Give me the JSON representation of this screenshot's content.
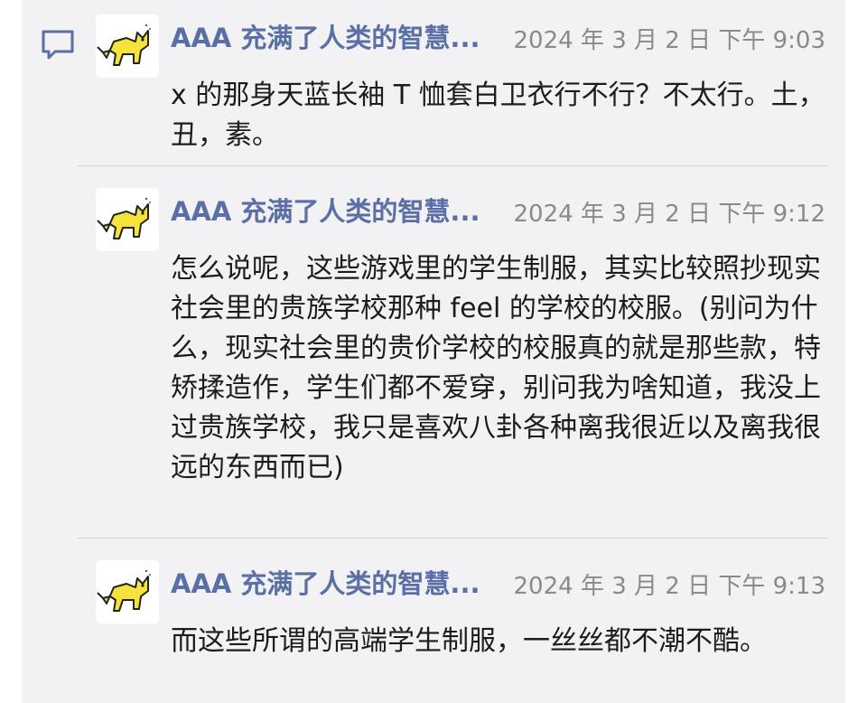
{
  "comments": [
    {
      "author": "AAA 充满了人类的智慧...",
      "time": "2024 年 3 月 2 日 下午 9:03",
      "text": "x 的那身天蓝长袖 T 恤套白卫衣行不行？不太行。土，丑，素。"
    },
    {
      "author": "AAA 充满了人类的智慧...",
      "time": "2024 年 3 月 2 日 下午 9:12",
      "text": "怎么说呢，这些游戏里的学生制服，其实比较照抄现实社会里的贵族学校那种 feel 的学校的校服。(别问为什么，现实社会里的贵价学校的校服真的就是那些款，特矫揉造作，学生们都不爱穿，别问我为啥知道，我没上过贵族学校，我只是喜欢八卦各种离我很近以及离我很远的东西而已)"
    },
    {
      "author": "AAA 充满了人类的智慧...",
      "time": "2024 年 3 月 2 日 下午 9:13",
      "text": "而这些所谓的高端学生制服，一丝丝都不潮不酷。"
    }
  ],
  "colors": {
    "panel_background": "#f2f2f4",
    "author": "#5a6fa6",
    "timestamp": "#8a8a8e",
    "body_text": "#1c1c1e",
    "icon": "#5a6fa6",
    "avatar_cat": "#f5e23a"
  },
  "icons": {
    "comment": "comment-icon",
    "avatar": "cat-avatar"
  }
}
